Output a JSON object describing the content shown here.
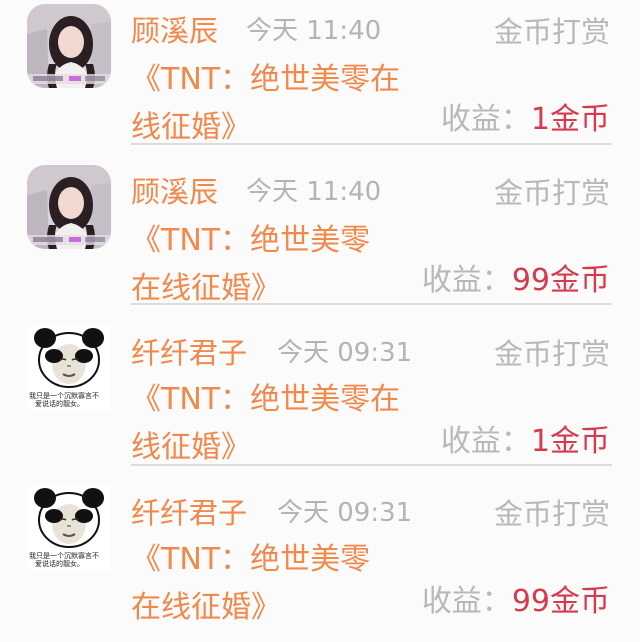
{
  "records": [
    {
      "avatar_icon": "girl-photo-avatar",
      "name": "顾溪辰",
      "time": "今天 11:40",
      "reward_label": "金币打赏",
      "title_line1": "《TNT：绝世美零在",
      "title_line2": "线征婚》",
      "income_label": "收益：",
      "income_amount": "1金币"
    },
    {
      "avatar_icon": "girl-photo-avatar",
      "name": "顾溪辰",
      "time": "今天 11:40",
      "reward_label": "金币打赏",
      "title_line1": "《TNT：绝世美零",
      "title_line2": "在线征婚》",
      "income_label": "收益：",
      "income_amount": "99金币"
    },
    {
      "avatar_icon": "panda-meme-avatar",
      "avatar_caption": "我只是一个沉默寡言不爱说话的靓女。",
      "name": "纤纤君子",
      "time": "今天 09:31",
      "reward_label": "金币打赏",
      "title_line1": "《TNT：绝世美零在",
      "title_line2": "线征婚》",
      "income_label": "收益：",
      "income_amount": "1金币"
    },
    {
      "avatar_icon": "panda-meme-avatar",
      "avatar_caption": "我只是一个沉默寡言不爱说话的靓女。",
      "name": "纤纤君子",
      "time": "今天 09:31",
      "reward_label": "金币打赏",
      "title_line1": "《TNT：绝世美零",
      "title_line2": "在线征婚》",
      "income_label": "收益：",
      "income_amount": "99金币"
    }
  ],
  "colors": {
    "name": "#f0894b",
    "title": "#f0894b",
    "muted": "#b8b8b8",
    "amount": "#d83a4c",
    "divider": "#dcdcdc",
    "background": "#fbfbfb"
  }
}
